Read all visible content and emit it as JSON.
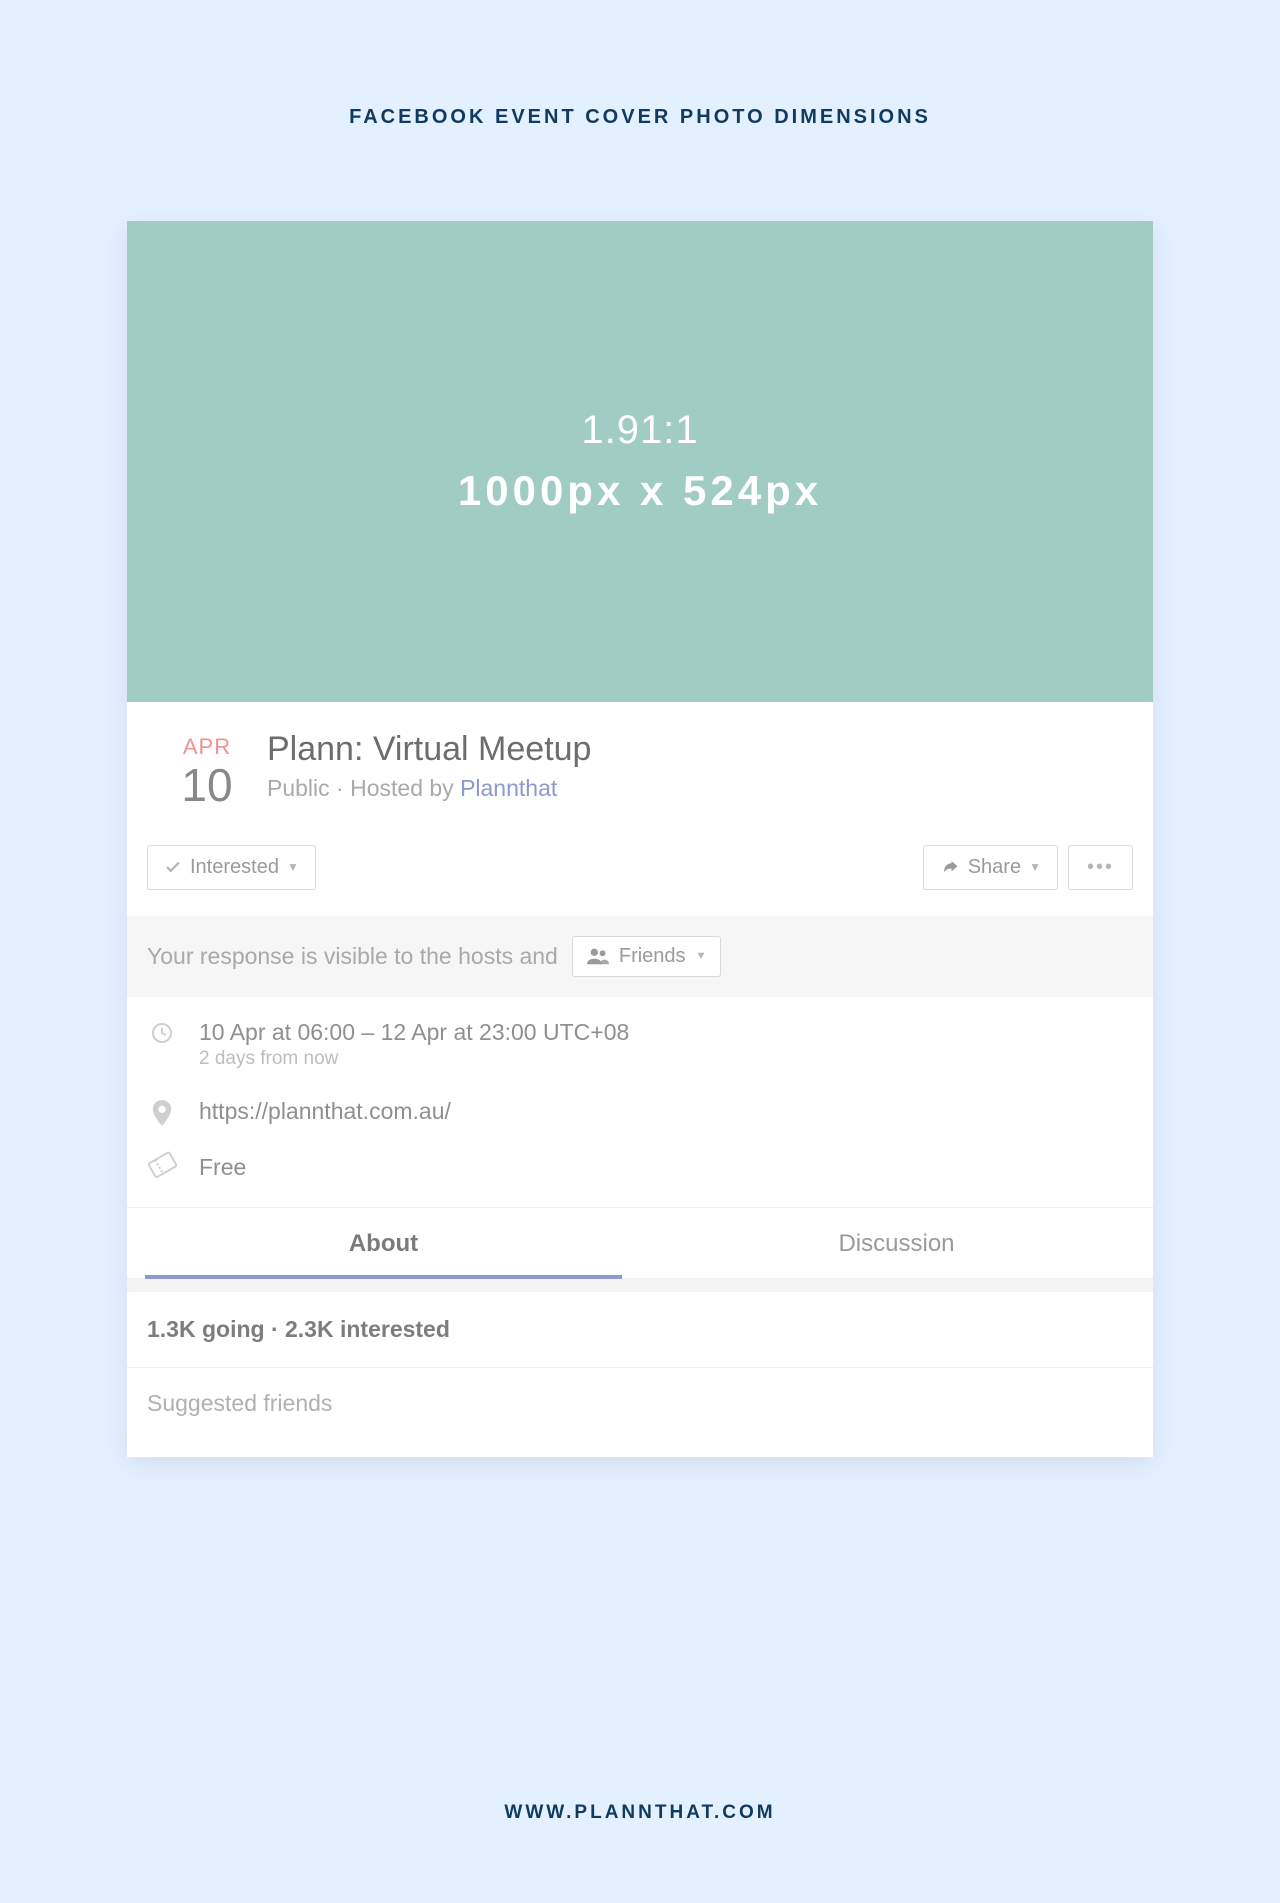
{
  "page": {
    "title": "FACEBOOK EVENT COVER PHOTO DIMENSIONS",
    "footer_url": "WWW.PLANNTHAT.COM"
  },
  "cover": {
    "ratio": "1.91:1",
    "dimensions": "1000px x 524px"
  },
  "event": {
    "month": "APR",
    "day": "10",
    "title": "Plann: Virtual Meetup",
    "privacy": "Public",
    "hosted_by_label": "Hosted by",
    "host_name": "Plannthat"
  },
  "buttons": {
    "interested": "Interested",
    "share": "Share"
  },
  "visibility": {
    "text": "Your response is visible to the hosts and",
    "audience": "Friends"
  },
  "details": {
    "time_range": "10 Apr at 06:00 – 12 Apr at 23:00 UTC+08",
    "time_relative": "2 days from now",
    "location": "https://plannthat.com.au/",
    "price": "Free"
  },
  "tabs": {
    "about": "About",
    "discussion": "Discussion"
  },
  "stats": {
    "text": "1.3K going · 2.3K interested"
  },
  "suggested": {
    "label": "Suggested friends"
  }
}
